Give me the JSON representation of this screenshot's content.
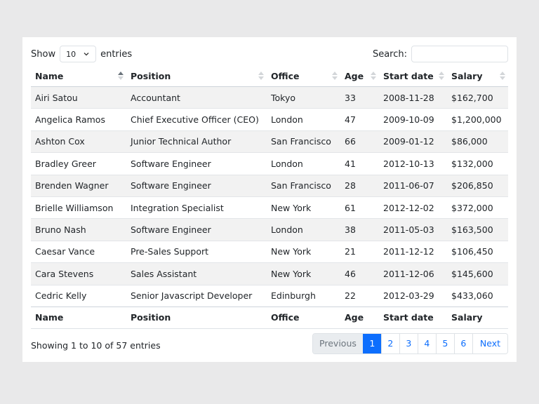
{
  "controls": {
    "show_label": "Show",
    "length_value": "10",
    "entries_label": "entries",
    "search_label": "Search:",
    "search_value": ""
  },
  "columns": [
    "Name",
    "Position",
    "Office",
    "Age",
    "Start date",
    "Salary"
  ],
  "rows": [
    [
      "Airi Satou",
      "Accountant",
      "Tokyo",
      "33",
      "2008-11-28",
      "$162,700"
    ],
    [
      "Angelica Ramos",
      "Chief Executive Officer (CEO)",
      "London",
      "47",
      "2009-10-09",
      "$1,200,000"
    ],
    [
      "Ashton Cox",
      "Junior Technical Author",
      "San Francisco",
      "66",
      "2009-01-12",
      "$86,000"
    ],
    [
      "Bradley Greer",
      "Software Engineer",
      "London",
      "41",
      "2012-10-13",
      "$132,000"
    ],
    [
      "Brenden Wagner",
      "Software Engineer",
      "San Francisco",
      "28",
      "2011-06-07",
      "$206,850"
    ],
    [
      "Brielle Williamson",
      "Integration Specialist",
      "New York",
      "61",
      "2012-12-02",
      "$372,000"
    ],
    [
      "Bruno Nash",
      "Software Engineer",
      "London",
      "38",
      "2011-05-03",
      "$163,500"
    ],
    [
      "Caesar Vance",
      "Pre-Sales Support",
      "New York",
      "21",
      "2011-12-12",
      "$106,450"
    ],
    [
      "Cara Stevens",
      "Sales Assistant",
      "New York",
      "46",
      "2011-12-06",
      "$145,600"
    ],
    [
      "Cedric Kelly",
      "Senior Javascript Developer",
      "Edinburgh",
      "22",
      "2012-03-29",
      "$433,060"
    ]
  ],
  "sort": {
    "column": "Name",
    "direction": "ascending"
  },
  "info": "Showing 1 to 10 of 57 entries",
  "pagination": {
    "previous": "Previous",
    "pages": [
      "1",
      "2",
      "3",
      "4",
      "5",
      "6"
    ],
    "current": "1",
    "next": "Next"
  },
  "colors": {
    "accent": "#0d6efd",
    "stripe": "#f2f2f2",
    "page_bg": "#e9e9ea"
  }
}
